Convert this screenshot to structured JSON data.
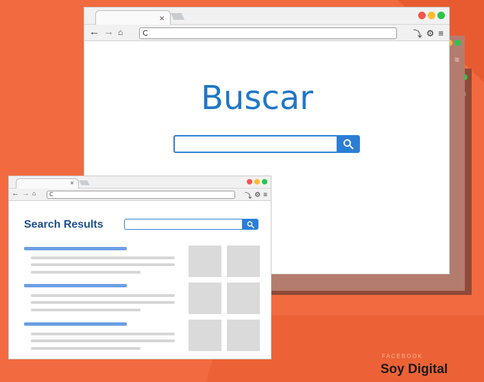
{
  "colors": {
    "background": "#f26a3f",
    "accent_blue": "#2b7ed6",
    "title_blue": "#1f77c6",
    "results_title_blue": "#1d4f8f",
    "dot_red": "#f5544d",
    "dot_yellow": "#fbbc2d",
    "dot_green": "#2ec24e"
  },
  "main_window": {
    "tab_close": "×",
    "address_text": "C",
    "heading": "Buscar",
    "search": {
      "placeholder": ""
    },
    "icons": [
      "back-arrow-icon",
      "forward-arrow-icon",
      "home-icon",
      "branch-icon",
      "gear-icon",
      "menu-icon",
      "search-icon"
    ]
  },
  "results_window": {
    "tab_close": "×",
    "address_text": "C",
    "heading": "Search Results",
    "search": {
      "placeholder": ""
    },
    "result_count": 3,
    "thumbnail_count": 6
  },
  "brand": {
    "top": "FACEBOOK",
    "bottom": "Soy Digital"
  }
}
